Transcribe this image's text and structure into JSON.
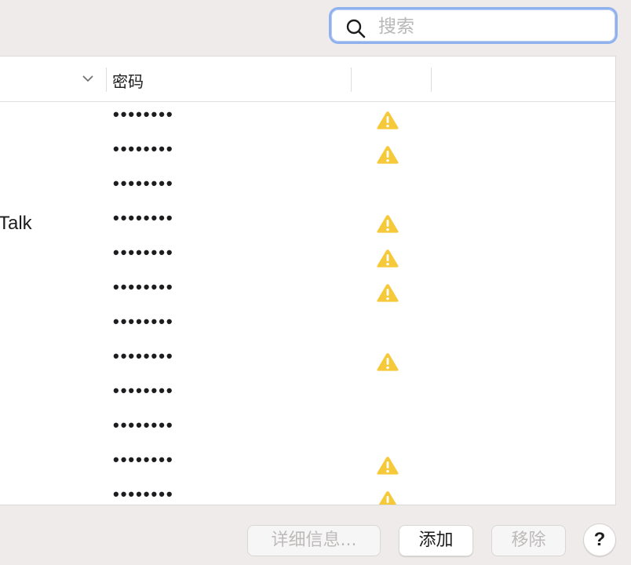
{
  "search": {
    "placeholder": "搜索",
    "value": ""
  },
  "table": {
    "columns": {
      "password": "密码"
    },
    "rows": [
      {
        "name": "",
        "password": "••••••••",
        "warning": true
      },
      {
        "name": "",
        "password": "••••••••",
        "warning": true
      },
      {
        "name": "",
        "password": "••••••••",
        "warning": false
      },
      {
        "name": "Talk",
        "password": "••••••••",
        "warning": true
      },
      {
        "name": "",
        "password": "••••••••",
        "warning": true
      },
      {
        "name": "",
        "password": "••••••••",
        "warning": true
      },
      {
        "name": "",
        "password": "••••••••",
        "warning": false
      },
      {
        "name": "",
        "password": "••••••••",
        "warning": true
      },
      {
        "name": "",
        "password": "••••••••",
        "warning": false
      },
      {
        "name": "",
        "password": "••••••••",
        "warning": false
      },
      {
        "name": "",
        "password": "••••••••",
        "warning": true
      },
      {
        "name": "",
        "password": "••••••••",
        "warning": true
      }
    ]
  },
  "buttons": {
    "details": "详细信息...",
    "add": "添加",
    "remove": "移除",
    "help": "?"
  },
  "colors": {
    "warning": "#f5c93a",
    "focus_ring": "#8fb2ef"
  }
}
